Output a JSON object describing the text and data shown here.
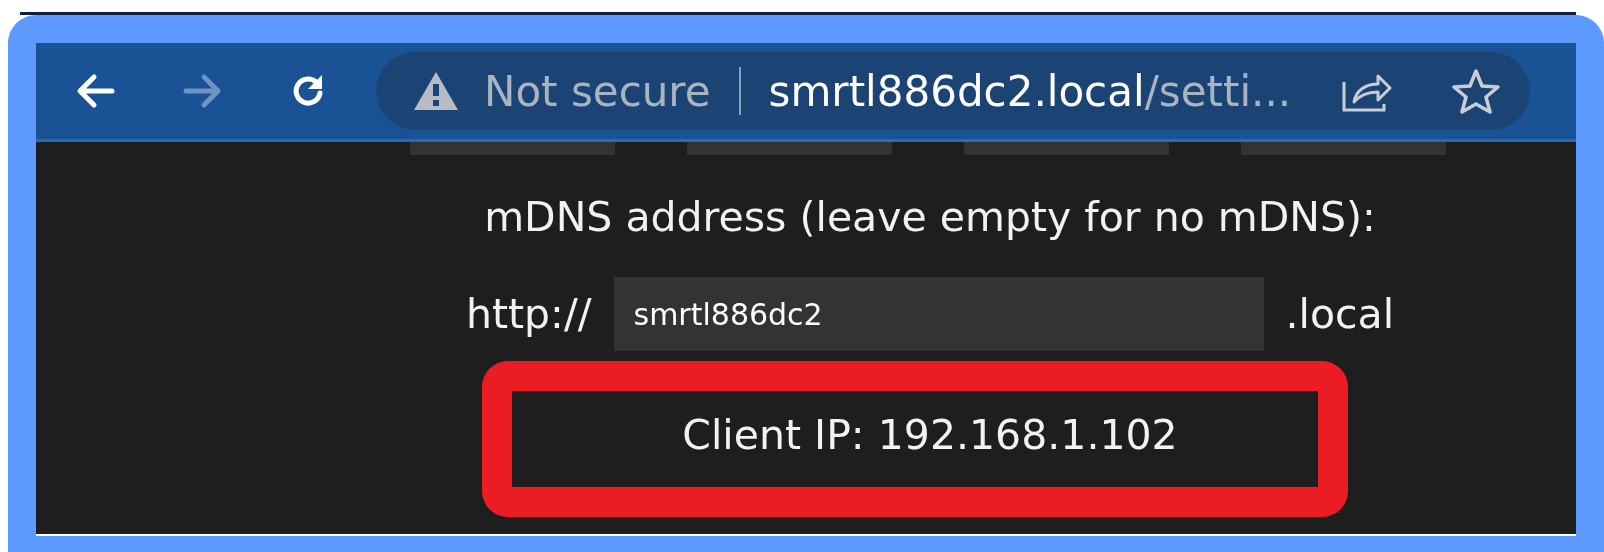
{
  "toolbar": {
    "nav_buttons": [
      {
        "kind": "back",
        "disabled": false
      },
      {
        "kind": "forward",
        "disabled": true
      },
      {
        "kind": "reload",
        "disabled": false
      }
    ],
    "security_label": "Not secure",
    "url": {
      "host": "smrtl886dc2.local",
      "path": "/setti..."
    }
  },
  "settings": {
    "mdns_label": "mDNS address (leave empty for no mDNS):",
    "url_prefix": "http://",
    "hostname_value": "smrtl886dc2",
    "url_suffix": ".local",
    "client_ip": "Client IP: 192.168.1.102"
  }
}
